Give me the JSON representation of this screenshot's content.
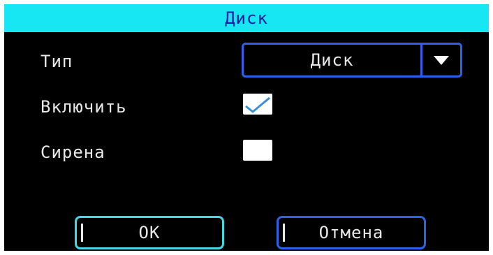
{
  "dialog": {
    "title": "Диск"
  },
  "fields": {
    "type_label": "Тип",
    "type_value": "Диск",
    "enable_label": "Включить",
    "enable_checked": true,
    "siren_label": "Сирена",
    "siren_checked": false
  },
  "buttons": {
    "ok_label": "OK",
    "cancel_label": "Отмена"
  },
  "colors": {
    "title_bar": "#17e6f3",
    "title_text": "#1b1f9e",
    "focus_border": "#2d62e8",
    "ok_border": "#44d9e0",
    "check_mark": "#3a8fd9"
  },
  "icons": {
    "dropdown": "triangle-down-icon",
    "checked": "checkmark-icon"
  }
}
